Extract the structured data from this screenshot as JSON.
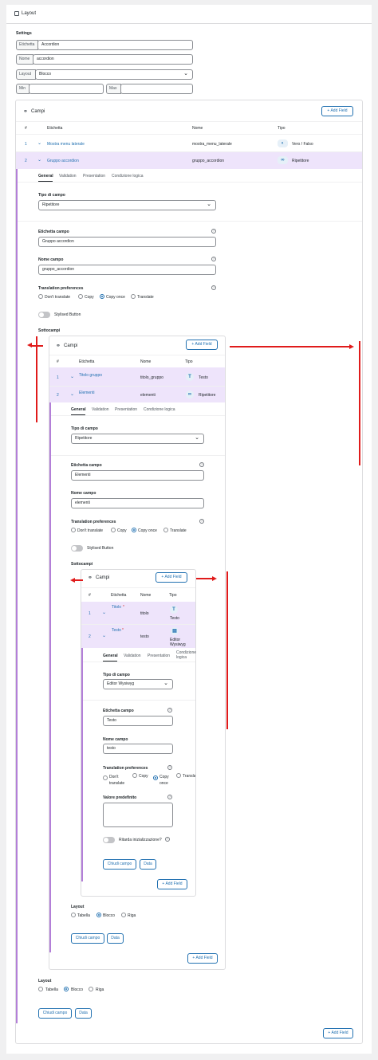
{
  "header": {
    "title": "Layout"
  },
  "settings": {
    "title": "Settings",
    "etichetta_prefix": "Etichetta",
    "etichetta_value": "Accordion",
    "nome_prefix": "Nome",
    "nome_value": "accordion",
    "layout_prefix": "Layout",
    "layout_value": "Blocco",
    "min_prefix": "Min",
    "max_prefix": "Max"
  },
  "campi": {
    "title": "Campi",
    "add_field": "+ Add Field",
    "columns": [
      "#",
      "Etichetta",
      "Nome",
      "Tipo"
    ],
    "rows": [
      {
        "num": "1",
        "label": "Mostra menu laterale",
        "name": "mostra_menu_laterale",
        "type": "Vero / Falso"
      },
      {
        "num": "2",
        "label": "Gruppo accordion",
        "name": "gruppo_accordion",
        "type": "Ripetitore"
      }
    ],
    "tabs": [
      "General",
      "Validation",
      "Presentation",
      "Condizione logica"
    ],
    "tipo_label": "Tipo di campo",
    "tipo_value": "Ripetitore",
    "etichetta_label": "Etichetta campo",
    "etichetta_value": "Gruppo accordion",
    "nome_label": "Nome campo",
    "nome_value": "gruppo_accordion",
    "translation_label": "Translation preferences",
    "translation_options": [
      "Don't translate",
      "Copy",
      "Copy once",
      "Translate"
    ],
    "stylized_label": "Stylised Button",
    "sottocampi_label": "Sottocampi",
    "layout_label": "Layout",
    "layout_options": [
      "Tabella",
      "Blocco",
      "Riga"
    ],
    "chiudi": "Chiudi campo",
    "data": "Data"
  },
  "sub1": {
    "title": "Campi",
    "add_field": "+ Add Field",
    "columns": [
      "#",
      "Etichetta",
      "Nome",
      "Tipo"
    ],
    "rows": [
      {
        "num": "1",
        "label": "Titolo gruppo",
        "name": "titolo_gruppo",
        "type": "Testo"
      },
      {
        "num": "2",
        "label": "Elementi",
        "name": "elementi",
        "type": "Ripetitore"
      }
    ],
    "tabs": [
      "General",
      "Validation",
      "Presentation",
      "Condizione logica"
    ],
    "tipo_label": "Tipo di campo",
    "tipo_value": "Ripetitore",
    "etichetta_label": "Etichetta campo",
    "etichetta_value": "Elementi",
    "nome_label": "Nome campo",
    "nome_value": "elementi",
    "translation_label": "Translation preferences",
    "translation_options": [
      "Don't translate",
      "Copy",
      "Copy once",
      "Translate"
    ],
    "stylized_label": "Stylised Button",
    "sottocampi_label": "Sottocampi",
    "layout_label": "Layout",
    "layout_options": [
      "Tabella",
      "Blocco",
      "Riga"
    ],
    "chiudi": "Chiudi campo",
    "data": "Data"
  },
  "sub2": {
    "title": "Campi",
    "add_field": "+ Add Field",
    "columns": [
      "#",
      "Etichetta",
      "Nome",
      "Tipo"
    ],
    "rows": [
      {
        "num": "1",
        "label": "Titolo",
        "required": "*",
        "name": "titolo",
        "type": "Testo"
      },
      {
        "num": "2",
        "label": "Testo",
        "required": "*",
        "name": "testo",
        "type": "Editor Wysiwyg"
      }
    ],
    "tabs": [
      "General",
      "Validation",
      "Presentation",
      "Condizione logica"
    ],
    "tipo_label": "Tipo di campo",
    "tipo_value": "Editor Wysiwyg",
    "etichetta_label": "Etichetta campo",
    "etichetta_value": "Testo",
    "nome_label": "Nome campo",
    "nome_value": "testo",
    "translation_label": "Translation preferences",
    "translation_options": [
      "Don't translate",
      "Copy",
      "Copy once",
      "Translate"
    ],
    "valore_label": "Valore predefinito",
    "ritarda_label": "Ritarda inizializzazione?",
    "chiudi": "Chiudi campo",
    "data": "Data"
  },
  "colors": {
    "accent": "#2271b1",
    "highlight": "#eee4fb",
    "purple_line": "#b37fd8",
    "annotation": "#e01b1b"
  }
}
